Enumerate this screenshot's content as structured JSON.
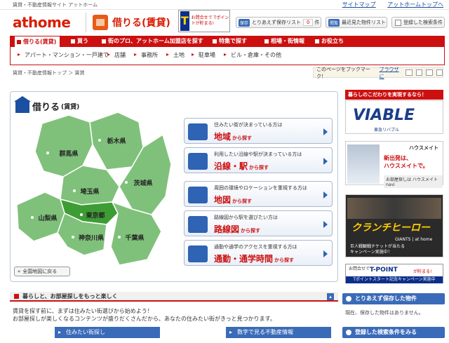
{
  "header": {
    "tagline": "賃貸・不動産情報サイト アットホーム",
    "toplinks": [
      "サイトマップ",
      "アットホームトップへ"
    ],
    "logo": "athome",
    "section_title": "借りる(賃貸)",
    "tpoint_ad": "お問合せで Tポイントが貯まる!",
    "save_list": {
      "prefix": "保存",
      "label": "とりあえず保存リスト",
      "count": "0",
      "unit": "件"
    },
    "recent": {
      "prefix": "閲覧",
      "label": "最近見た物件リスト"
    },
    "saved_search": "登録した検索条件"
  },
  "nav": {
    "items": [
      "借りる(賃貸)",
      "買う",
      "街のプロ、アットホーム加盟店を探す",
      "特集で探す",
      "相場・街情報",
      "お役立ち"
    ],
    "sub": [
      "アパート・マンション・一戸建て",
      "店舗",
      "事務所",
      "土地",
      "駐車場",
      "ビル・倉庫・その他"
    ]
  },
  "breadcrumb": "賃貸・不動産情報トップ ＞ 賃貸",
  "bookmark_label": "このページをブックマーク！",
  "bookmark_browser": "ブラウザに",
  "panel": {
    "title": "借りる",
    "title_small": "(賃貸)",
    "back_button": "全国地図に戻る",
    "prefectures": [
      "群馬県",
      "栃木県",
      "茨城県",
      "埼玉県",
      "東京都",
      "山梨県",
      "神奈川県",
      "千葉県"
    ],
    "options": [
      {
        "desc": "住みたい街が決まっている方は",
        "big": "地域",
        "suffix": "から探す"
      },
      {
        "desc": "利用したい沿線や駅が決まっている方は",
        "big": "沿線・駅",
        "suffix": "から探す"
      },
      {
        "desc": "周囲の環境やロケーションを重視する方は",
        "big": "地図",
        "suffix": "から探す"
      },
      {
        "desc": "路線図から駅を選びたい方は",
        "big": "路線図",
        "suffix": "から探す"
      },
      {
        "desc": "通勤や通学のアクセスを重視する方は",
        "big": "通勤・通学時間",
        "suffix": "から探す"
      }
    ]
  },
  "sidebar": {
    "header": "暮らしのこだわりを実現するなら！",
    "ad1": {
      "brand": "VIABLE",
      "sub": "東急リバブル"
    },
    "ad2": {
      "brand": "ハウスメイト",
      "copy1": "新出発は、",
      "copy2": "ハウスメイトで。",
      "tag": "お部屋探しは ハウスメイト navi"
    },
    "ad3": {
      "title": "クランチヒーロー",
      "sub": "GIANTS | at home",
      "desc1": "巨人戦観戦チケットが当たる",
      "desc2": "キャンペーン実施中！"
    },
    "ad4": {
      "left": "お問合せで",
      "brand": "T-POINT",
      "right": "が貯まる!",
      "bar": "Tポイントスタート記念キャンペーン実施中"
    }
  },
  "section2": {
    "title": "暮らしと、お部屋探しをもっと楽しく",
    "line1": "賃貸を探す前に、まずは住みたい街選びから始めよう！",
    "line2": "お部屋探しが楽しくなるコンテンツが盛りだくさんだから、あなたの住みたい街がきっと見つかります。",
    "tabs": [
      "住みたい街探し",
      "数字で見る不動産情報"
    ]
  },
  "saved_box": {
    "title": "とりあえず保存した物件",
    "note": "現在、保存した物件はありません。"
  },
  "registered_box": "登録した検索条件をみる",
  "colors": {
    "brand_red": "#cc1010",
    "link_blue": "#1a4a9a",
    "map_green": "#7fc17a",
    "map_highlight": "#3e9c35"
  }
}
